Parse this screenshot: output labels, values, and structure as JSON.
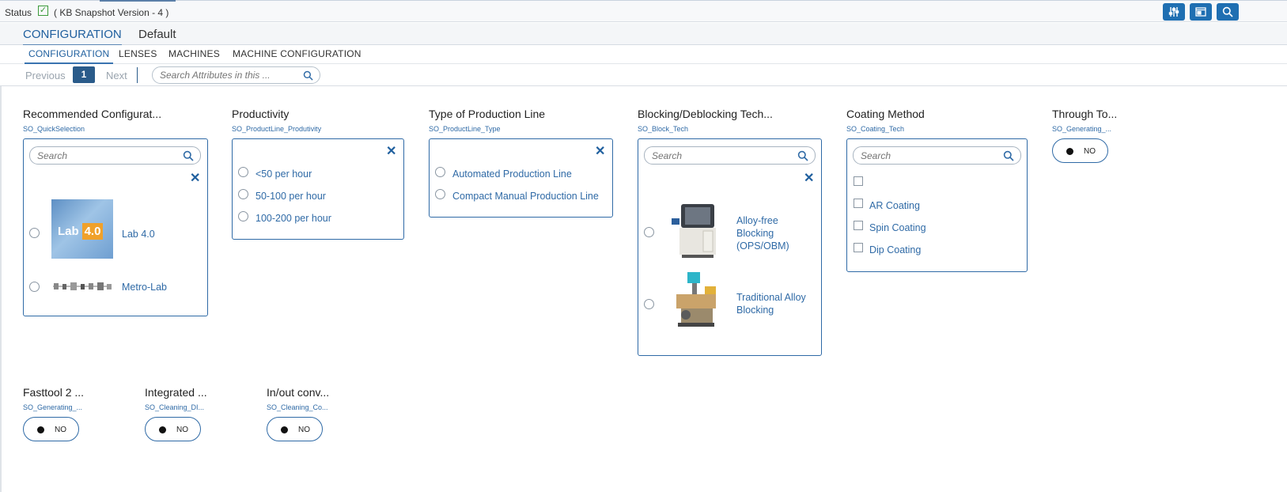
{
  "status": {
    "label": "Status",
    "version": "( KB Snapshot Version - 4 )"
  },
  "toolbar": {
    "buttons": [
      {
        "icon": "sliders-icon"
      },
      {
        "icon": "screen-icon"
      },
      {
        "icon": "search-icon"
      }
    ]
  },
  "main_tabs": [
    "CONFIGURATION",
    "Default"
  ],
  "sub_tabs": [
    "CONFIGURATION",
    "LENSES",
    "MACHINES",
    "MACHINE CONFIGURATION"
  ],
  "pager": {
    "previous": "Previous",
    "page": "1",
    "next": "Next",
    "search_placeholder": "Search Attributes in this ..."
  },
  "fields": {
    "recommended": {
      "title": "Recommended Configurat...",
      "code": "SO_QuickSelection",
      "search_placeholder": "Search",
      "options": [
        {
          "label": "Lab 4.0",
          "image_text": "Lab",
          "image_badge": "4.0"
        },
        {
          "label": "Metro-Lab"
        }
      ]
    },
    "productivity": {
      "title": "Productivity",
      "code": "SO_ProductLine_Produtivity",
      "options": [
        "<50 per hour",
        "50-100 per hour",
        "100-200 per hour"
      ]
    },
    "line_type": {
      "title": "Type of Production Line",
      "code": "SO_ProductLine_Type",
      "options": [
        "Automated Production Line",
        "Compact Manual Production Line"
      ]
    },
    "blocking": {
      "title": "Blocking/Deblocking Tech...",
      "code": "SO_Block_Tech",
      "search_placeholder": "Search",
      "options": [
        "Alloy-free Blocking (OPS/OBM)",
        "Traditional Alloy Blocking"
      ]
    },
    "coating": {
      "title": "Coating Method",
      "code": "SO_Coating_Tech",
      "search_placeholder": "Search",
      "options": [
        "",
        "AR Coating",
        "Spin Coating",
        "Dip Coating"
      ]
    },
    "through": {
      "title": "Through To...",
      "code": "SO_Generating_...",
      "value": "NO"
    },
    "fasttool": {
      "title": "Fasttool 2 ...",
      "code": "SO_Generating_...",
      "value": "NO"
    },
    "integrated": {
      "title": "Integrated ...",
      "code": "SO_Cleaning_DI...",
      "value": "NO"
    },
    "inout": {
      "title": "In/out conv...",
      "code": "SO_Cleaning_Co...",
      "value": "NO"
    }
  },
  "colors": {
    "accent": "#1f6fb2",
    "link": "#2f6aa6",
    "page_active": "#2a5b8a"
  }
}
